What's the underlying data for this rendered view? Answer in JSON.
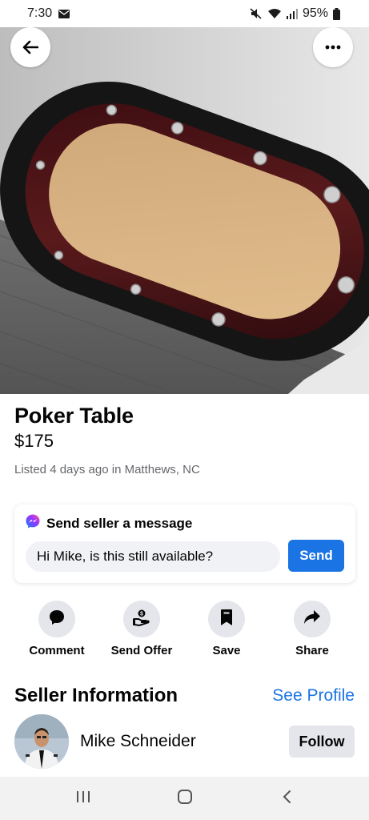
{
  "status_bar": {
    "time": "7:30",
    "battery": "95%"
  },
  "listing": {
    "title": "Poker Table",
    "price": "$175",
    "listed": "Listed 4 days ago in Matthews, NC"
  },
  "message": {
    "heading": "Send seller a message",
    "input_value": "Hi Mike, is this still available?",
    "send_label": "Send"
  },
  "actions": [
    {
      "label": "Comment",
      "icon": "comment-icon"
    },
    {
      "label": "Send Offer",
      "icon": "send-offer-icon"
    },
    {
      "label": "Save",
      "icon": "bookmark-icon"
    },
    {
      "label": "Share",
      "icon": "share-icon"
    }
  ],
  "seller": {
    "heading": "Seller Information",
    "see_profile": "See Profile",
    "name": "Mike Schneider",
    "follow_label": "Follow"
  },
  "colors": {
    "accent": "#1b74e4",
    "secondary_button": "#e4e6eb",
    "muted_text": "#65676b"
  }
}
